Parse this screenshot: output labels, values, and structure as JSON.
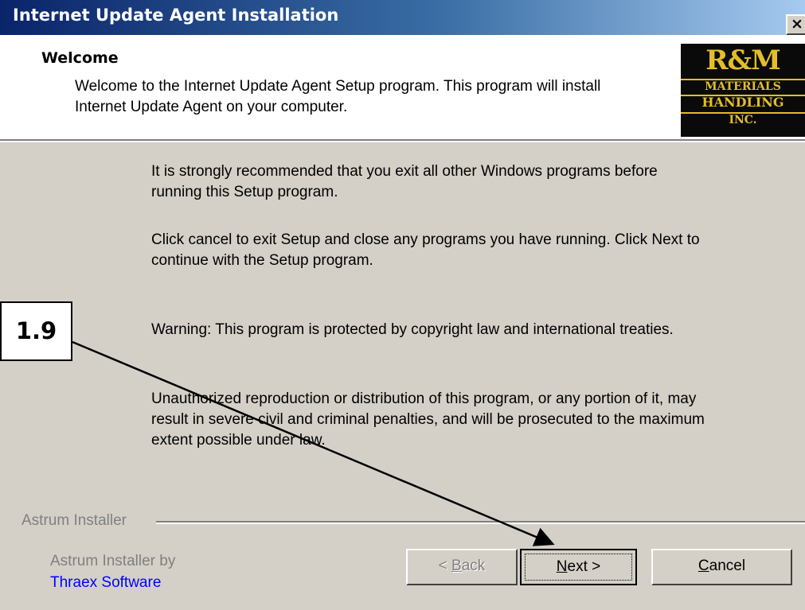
{
  "window": {
    "title": "Internet Update Agent Installation",
    "close_symbol": "×"
  },
  "header": {
    "heading": "Welcome",
    "description": "Welcome to the Internet Update Agent Setup program. This program will install Internet Update Agent on your computer."
  },
  "logo": {
    "line1": "R&M",
    "line2": "MATERIALS",
    "line3": "HANDLING",
    "line4": "INC."
  },
  "body": {
    "paragraphs": [
      "It is strongly recommended that you exit all other Windows programs before running this Setup program.",
      "Click cancel to exit Setup and close any programs you have running. Click Next to continue with the Setup program.",
      "Warning: This program is protected by copyright law and international treaties.",
      "Unauthorized reproduction or distribution of this program, or any portion of it, may result in severe civil and criminal penalties, and will be prosecuted to the maximum extent possible under law."
    ]
  },
  "footer": {
    "group_label": "Astrum Installer",
    "credit_line1": "Astrum Installer by",
    "credit_line2": "Thraex Software"
  },
  "buttons": {
    "back_prefix": "< ",
    "back_mnemonic": "B",
    "back_rest": "ack",
    "next_mnemonic": "N",
    "next_rest": "ext >",
    "cancel_mnemonic": "C",
    "cancel_rest": "ancel"
  },
  "annotation": {
    "label": "1.9"
  },
  "colors": {
    "titlebar_start": "#0a246a",
    "titlebar_end": "#a6caf0",
    "dialog_face": "#d4d0c8",
    "logo_gold": "#e3bd2a",
    "link_blue": "#0000ff"
  }
}
